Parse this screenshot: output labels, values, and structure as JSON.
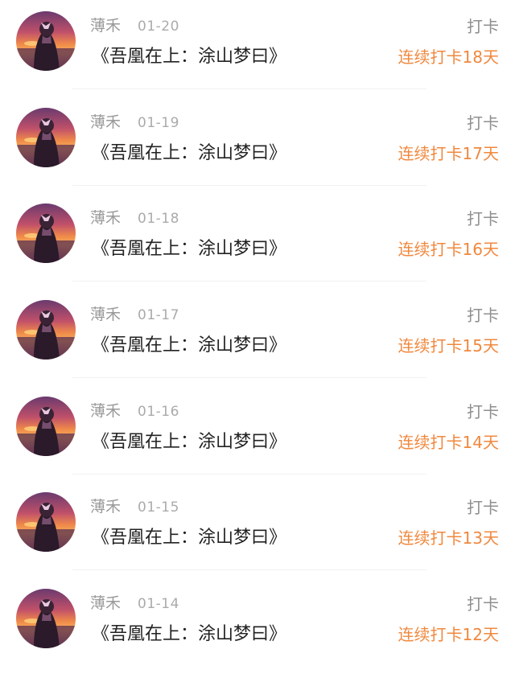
{
  "colors": {
    "streak": "#f0883e",
    "username": "#9a9a9a",
    "date": "#ababab",
    "title": "#222222",
    "type": "#8f8f8f",
    "divider": "#f1f1f1"
  },
  "avatar_icon": "sunset-portrait-avatar",
  "entries": [
    {
      "user": "薄禾",
      "date": "01-20",
      "book": "《吾凰在上：涂山梦曰》",
      "type": "打卡",
      "streak": "连续打卡18天"
    },
    {
      "user": "薄禾",
      "date": "01-19",
      "book": "《吾凰在上：涂山梦曰》",
      "type": "打卡",
      "streak": "连续打卡17天"
    },
    {
      "user": "薄禾",
      "date": "01-18",
      "book": "《吾凰在上：涂山梦曰》",
      "type": "打卡",
      "streak": "连续打卡16天"
    },
    {
      "user": "薄禾",
      "date": "01-17",
      "book": "《吾凰在上：涂山梦曰》",
      "type": "打卡",
      "streak": "连续打卡15天"
    },
    {
      "user": "薄禾",
      "date": "01-16",
      "book": "《吾凰在上：涂山梦曰》",
      "type": "打卡",
      "streak": "连续打卡14天"
    },
    {
      "user": "薄禾",
      "date": "01-15",
      "book": "《吾凰在上：涂山梦曰》",
      "type": "打卡",
      "streak": "连续打卡13天"
    },
    {
      "user": "薄禾",
      "date": "01-14",
      "book": "《吾凰在上：涂山梦曰》",
      "type": "打卡",
      "streak": "连续打卡12天"
    }
  ]
}
